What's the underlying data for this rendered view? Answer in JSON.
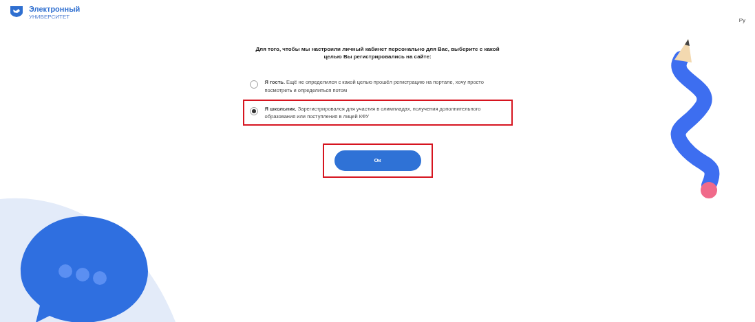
{
  "header": {
    "logo_title": "Электронный",
    "logo_subtitle": "УНИВЕРСИТЕТ",
    "language": "Ру"
  },
  "prompt": "Для того, чтобы мы настроили личный кабинет персонально для Вас, выберите с какой целью Вы регистрировались на сайте:",
  "options": [
    {
      "text": "**Я гость.** Ещё не определился с какой целью прошёл регистрацию на портале, хочу просто посмотреть и определиться потом",
      "selected": false,
      "highlighted": false
    },
    {
      "text": "**Я школьник.** Зарегистрировался для участия в олимпиадах, получения дополнительного образования или поступления в лицей КФУ",
      "selected": true,
      "highlighted": true
    }
  ],
  "ok_button": {
    "label": "Ок",
    "highlighted": true
  }
}
